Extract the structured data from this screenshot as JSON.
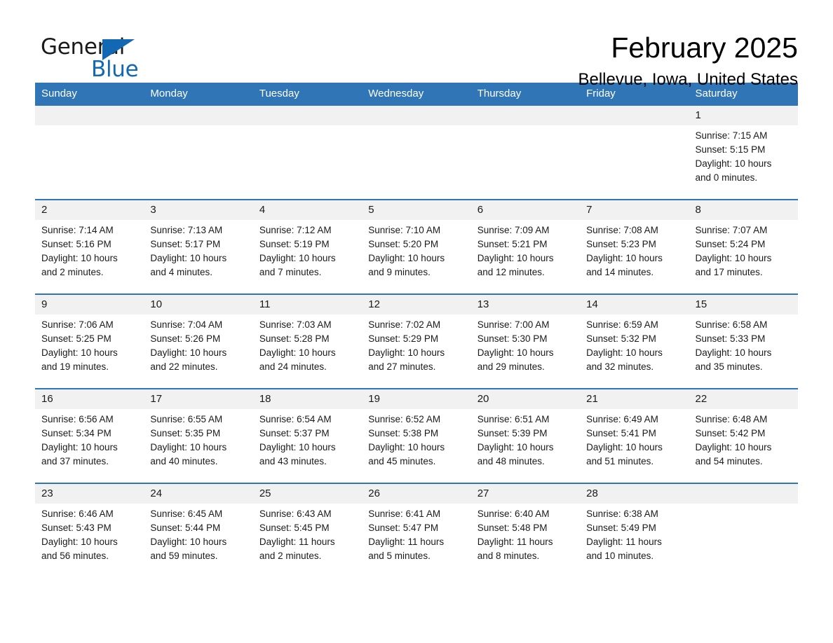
{
  "brand": {
    "name_part1": "General",
    "name_part2": "Blue",
    "triangle_color": "#1268b3"
  },
  "header": {
    "month_title": "February 2025",
    "location": "Bellevue, Iowa, United States"
  },
  "theme": {
    "header_blue": "#3075b5",
    "daynum_grey": "#f1f1f1",
    "text_black": "#1a1a1a"
  },
  "calendar": {
    "weekday_headers": [
      "Sunday",
      "Monday",
      "Tuesday",
      "Wednesday",
      "Thursday",
      "Friday",
      "Saturday"
    ],
    "weeks": [
      [
        {
          "day": "",
          "sunrise": "",
          "sunset": "",
          "daylight_line1": "",
          "daylight_line2": ""
        },
        {
          "day": "",
          "sunrise": "",
          "sunset": "",
          "daylight_line1": "",
          "daylight_line2": ""
        },
        {
          "day": "",
          "sunrise": "",
          "sunset": "",
          "daylight_line1": "",
          "daylight_line2": ""
        },
        {
          "day": "",
          "sunrise": "",
          "sunset": "",
          "daylight_line1": "",
          "daylight_line2": ""
        },
        {
          "day": "",
          "sunrise": "",
          "sunset": "",
          "daylight_line1": "",
          "daylight_line2": ""
        },
        {
          "day": "",
          "sunrise": "",
          "sunset": "",
          "daylight_line1": "",
          "daylight_line2": ""
        },
        {
          "day": "1",
          "sunrise": "Sunrise: 7:15 AM",
          "sunset": "Sunset: 5:15 PM",
          "daylight_line1": "Daylight: 10 hours",
          "daylight_line2": "and 0 minutes."
        }
      ],
      [
        {
          "day": "2",
          "sunrise": "Sunrise: 7:14 AM",
          "sunset": "Sunset: 5:16 PM",
          "daylight_line1": "Daylight: 10 hours",
          "daylight_line2": "and 2 minutes."
        },
        {
          "day": "3",
          "sunrise": "Sunrise: 7:13 AM",
          "sunset": "Sunset: 5:17 PM",
          "daylight_line1": "Daylight: 10 hours",
          "daylight_line2": "and 4 minutes."
        },
        {
          "day": "4",
          "sunrise": "Sunrise: 7:12 AM",
          "sunset": "Sunset: 5:19 PM",
          "daylight_line1": "Daylight: 10 hours",
          "daylight_line2": "and 7 minutes."
        },
        {
          "day": "5",
          "sunrise": "Sunrise: 7:10 AM",
          "sunset": "Sunset: 5:20 PM",
          "daylight_line1": "Daylight: 10 hours",
          "daylight_line2": "and 9 minutes."
        },
        {
          "day": "6",
          "sunrise": "Sunrise: 7:09 AM",
          "sunset": "Sunset: 5:21 PM",
          "daylight_line1": "Daylight: 10 hours",
          "daylight_line2": "and 12 minutes."
        },
        {
          "day": "7",
          "sunrise": "Sunrise: 7:08 AM",
          "sunset": "Sunset: 5:23 PM",
          "daylight_line1": "Daylight: 10 hours",
          "daylight_line2": "and 14 minutes."
        },
        {
          "day": "8",
          "sunrise": "Sunrise: 7:07 AM",
          "sunset": "Sunset: 5:24 PM",
          "daylight_line1": "Daylight: 10 hours",
          "daylight_line2": "and 17 minutes."
        }
      ],
      [
        {
          "day": "9",
          "sunrise": "Sunrise: 7:06 AM",
          "sunset": "Sunset: 5:25 PM",
          "daylight_line1": "Daylight: 10 hours",
          "daylight_line2": "and 19 minutes."
        },
        {
          "day": "10",
          "sunrise": "Sunrise: 7:04 AM",
          "sunset": "Sunset: 5:26 PM",
          "daylight_line1": "Daylight: 10 hours",
          "daylight_line2": "and 22 minutes."
        },
        {
          "day": "11",
          "sunrise": "Sunrise: 7:03 AM",
          "sunset": "Sunset: 5:28 PM",
          "daylight_line1": "Daylight: 10 hours",
          "daylight_line2": "and 24 minutes."
        },
        {
          "day": "12",
          "sunrise": "Sunrise: 7:02 AM",
          "sunset": "Sunset: 5:29 PM",
          "daylight_line1": "Daylight: 10 hours",
          "daylight_line2": "and 27 minutes."
        },
        {
          "day": "13",
          "sunrise": "Sunrise: 7:00 AM",
          "sunset": "Sunset: 5:30 PM",
          "daylight_line1": "Daylight: 10 hours",
          "daylight_line2": "and 29 minutes."
        },
        {
          "day": "14",
          "sunrise": "Sunrise: 6:59 AM",
          "sunset": "Sunset: 5:32 PM",
          "daylight_line1": "Daylight: 10 hours",
          "daylight_line2": "and 32 minutes."
        },
        {
          "day": "15",
          "sunrise": "Sunrise: 6:58 AM",
          "sunset": "Sunset: 5:33 PM",
          "daylight_line1": "Daylight: 10 hours",
          "daylight_line2": "and 35 minutes."
        }
      ],
      [
        {
          "day": "16",
          "sunrise": "Sunrise: 6:56 AM",
          "sunset": "Sunset: 5:34 PM",
          "daylight_line1": "Daylight: 10 hours",
          "daylight_line2": "and 37 minutes."
        },
        {
          "day": "17",
          "sunrise": "Sunrise: 6:55 AM",
          "sunset": "Sunset: 5:35 PM",
          "daylight_line1": "Daylight: 10 hours",
          "daylight_line2": "and 40 minutes."
        },
        {
          "day": "18",
          "sunrise": "Sunrise: 6:54 AM",
          "sunset": "Sunset: 5:37 PM",
          "daylight_line1": "Daylight: 10 hours",
          "daylight_line2": "and 43 minutes."
        },
        {
          "day": "19",
          "sunrise": "Sunrise: 6:52 AM",
          "sunset": "Sunset: 5:38 PM",
          "daylight_line1": "Daylight: 10 hours",
          "daylight_line2": "and 45 minutes."
        },
        {
          "day": "20",
          "sunrise": "Sunrise: 6:51 AM",
          "sunset": "Sunset: 5:39 PM",
          "daylight_line1": "Daylight: 10 hours",
          "daylight_line2": "and 48 minutes."
        },
        {
          "day": "21",
          "sunrise": "Sunrise: 6:49 AM",
          "sunset": "Sunset: 5:41 PM",
          "daylight_line1": "Daylight: 10 hours",
          "daylight_line2": "and 51 minutes."
        },
        {
          "day": "22",
          "sunrise": "Sunrise: 6:48 AM",
          "sunset": "Sunset: 5:42 PM",
          "daylight_line1": "Daylight: 10 hours",
          "daylight_line2": "and 54 minutes."
        }
      ],
      [
        {
          "day": "23",
          "sunrise": "Sunrise: 6:46 AM",
          "sunset": "Sunset: 5:43 PM",
          "daylight_line1": "Daylight: 10 hours",
          "daylight_line2": "and 56 minutes."
        },
        {
          "day": "24",
          "sunrise": "Sunrise: 6:45 AM",
          "sunset": "Sunset: 5:44 PM",
          "daylight_line1": "Daylight: 10 hours",
          "daylight_line2": "and 59 minutes."
        },
        {
          "day": "25",
          "sunrise": "Sunrise: 6:43 AM",
          "sunset": "Sunset: 5:45 PM",
          "daylight_line1": "Daylight: 11 hours",
          "daylight_line2": "and 2 minutes."
        },
        {
          "day": "26",
          "sunrise": "Sunrise: 6:41 AM",
          "sunset": "Sunset: 5:47 PM",
          "daylight_line1": "Daylight: 11 hours",
          "daylight_line2": "and 5 minutes."
        },
        {
          "day": "27",
          "sunrise": "Sunrise: 6:40 AM",
          "sunset": "Sunset: 5:48 PM",
          "daylight_line1": "Daylight: 11 hours",
          "daylight_line2": "and 8 minutes."
        },
        {
          "day": "28",
          "sunrise": "Sunrise: 6:38 AM",
          "sunset": "Sunset: 5:49 PM",
          "daylight_line1": "Daylight: 11 hours",
          "daylight_line2": "and 10 minutes."
        },
        {
          "day": "",
          "sunrise": "",
          "sunset": "",
          "daylight_line1": "",
          "daylight_line2": ""
        }
      ]
    ]
  }
}
